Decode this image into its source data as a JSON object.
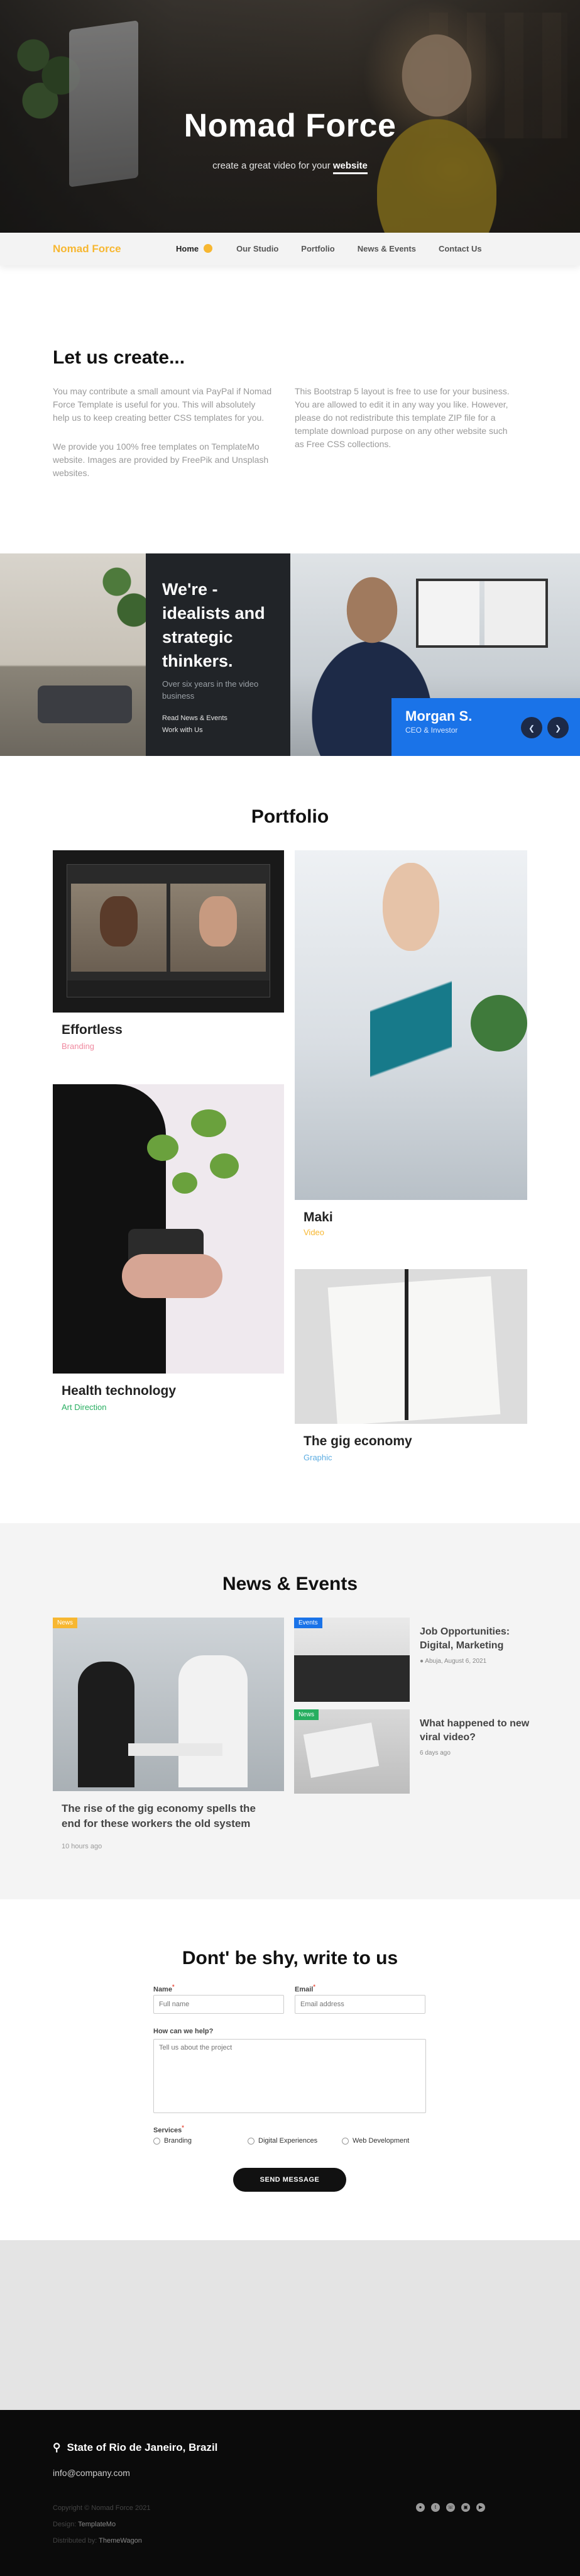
{
  "hero": {
    "title": "Nomad Force",
    "subtitle_prefix": "create a great video for your",
    "subtitle_link": "website"
  },
  "nav": {
    "brand": "Nomad Force",
    "items": [
      "Home",
      "Our Studio",
      "Portfolio",
      "News & Events",
      "Contact Us"
    ]
  },
  "intro": {
    "heading": "Let us create...",
    "p1": "You may contribute a small amount via PayPal if Nomad Force Template is useful for you. This will absolutely help us to keep creating better CSS templates for you.",
    "p2": "We provide you 100% free templates on TemplateMo website. Images are provided by FreePik and Unsplash websites.",
    "p3": "This Bootstrap 5 layout is free to use for your business. You are allowed to edit it in any way you like. However, please do not redistribute this template ZIP file for a template download purpose on any other website such as Free CSS collections."
  },
  "feature": {
    "heading": "We're - idealists and strategic thinkers.",
    "text": "Over six years in the video business",
    "links": [
      "Read News & Events",
      "Work with Us"
    ],
    "person_name": "Morgan S.",
    "person_role": "CEO & Investor",
    "prev_icon": "chevron-left-icon",
    "next_icon": "chevron-right-icon"
  },
  "portfolio": {
    "heading": "Portfolio",
    "items": [
      {
        "title": "Effortless",
        "category": "Branding",
        "color": "#f08aa0"
      },
      {
        "title": "Maki",
        "category": "Video",
        "color": "#f7b731"
      },
      {
        "title": "Health technology",
        "category": "Art Direction",
        "color": "#27ae60"
      },
      {
        "title": "The gig economy",
        "category": "Graphic",
        "color": "#5dade2"
      }
    ]
  },
  "news": {
    "heading": "News & Events",
    "main": {
      "badge": "News",
      "title": "The rise of the gig economy spells the end for these workers the old system",
      "time": "10 hours ago"
    },
    "side": [
      {
        "badge": "Events",
        "title": "Job Opportunities: Digital, Marketing",
        "meta": "Abuja, August 6, 2021",
        "badge_color": "#1a73e8"
      },
      {
        "badge": "News",
        "title": "What happened to new viral video?",
        "meta": "6 days ago",
        "badge_color": "#27ae60"
      }
    ]
  },
  "contact": {
    "heading": "Dont' be shy, write to us",
    "name_label": "Name",
    "name_placeholder": "Full name",
    "email_label": "Email",
    "email_placeholder": "Email address",
    "message_label": "How can we help?",
    "message_placeholder": "Tell us about the project",
    "services_label": "Services",
    "services": [
      "Branding",
      "Digital Experiences",
      "Web Development"
    ],
    "submit": "SEND MESSAGE"
  },
  "footer": {
    "address": "State of Rio de Janeiro, Brazil",
    "email": "info@company.com",
    "copyright": "Copyright © Nomad Force 2021",
    "design_label": "Design:",
    "design_value": "TemplateMo",
    "dist_label": "Distributed by:",
    "dist_value": "ThemeWagon",
    "social_icons": [
      "dribbble-icon",
      "twitter-icon",
      "whatsapp-icon",
      "instagram-icon",
      "youtube-icon"
    ]
  }
}
